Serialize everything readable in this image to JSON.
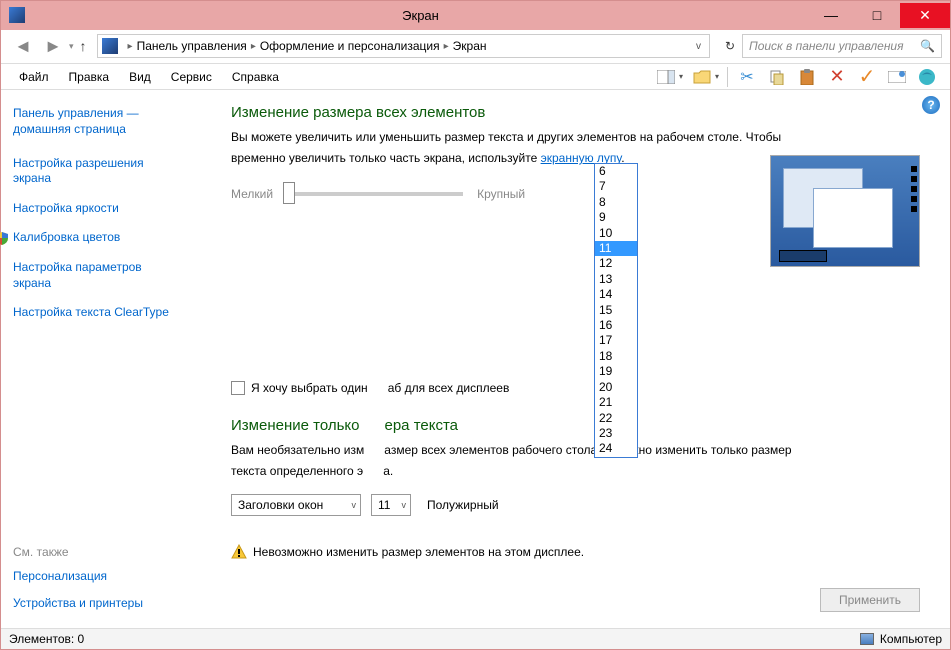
{
  "window": {
    "title": "Экран"
  },
  "breadcrumb": {
    "root": "Панель управления",
    "mid": "Оформление и персонализация",
    "leaf": "Экран"
  },
  "search": {
    "placeholder": "Поиск в панели управления"
  },
  "menu": {
    "file": "Файл",
    "edit": "Правка",
    "view": "Вид",
    "tools": "Сервис",
    "help": "Справка"
  },
  "sidebar": {
    "home1": "Панель управления —",
    "home2": "домашняя страница",
    "resolution1": "Настройка разрешения",
    "resolution2": "экрана",
    "brightness": "Настройка яркости",
    "calibration": "Калибровка цветов",
    "params1": "Настройка параметров",
    "params2": "экрана",
    "cleartype": "Настройка текста ClearType",
    "seealso": "См. также",
    "personalization": "Персонализация",
    "devices": "Устройства и принтеры"
  },
  "main": {
    "heading1": "Изменение размера всех элементов",
    "desc1a": "Вы можете увеличить или уменьшить размер текста и других элементов на рабочем столе. Чтобы",
    "desc1b_prefix": "временно увеличить только часть экрана, используйте ",
    "desc1b_link": "экранную лупу",
    "desc1b_suffix": ".",
    "slider_small": "Мелкий",
    "slider_large": "Крупный",
    "checkbox_custom1": "Я хочу выбрать один",
    "checkbox_custom2": "аб для всех дисплеев",
    "heading2a": "Изменение только",
    "heading2b": "ера текста",
    "desc2a_prefix": "Вам необязательно изм",
    "desc2a_suffix": "азмер всех элементов рабочего стола — можно изменить только размер",
    "desc2b_prefix": "текста определенного э",
    "desc2b_suffix": "а.",
    "element_combo": "Заголовки окон",
    "size_combo": "11",
    "bold_label": "Полужирный",
    "warning": "Невозможно изменить размер элементов на этом дисплее.",
    "apply": "Применить"
  },
  "size_options": [
    "6",
    "7",
    "8",
    "9",
    "10",
    "11",
    "12",
    "13",
    "14",
    "15",
    "16",
    "17",
    "18",
    "19",
    "20",
    "21",
    "22",
    "23",
    "24"
  ],
  "size_selected": "11",
  "status": {
    "left": "Элементов: 0",
    "right": "Компьютер"
  }
}
